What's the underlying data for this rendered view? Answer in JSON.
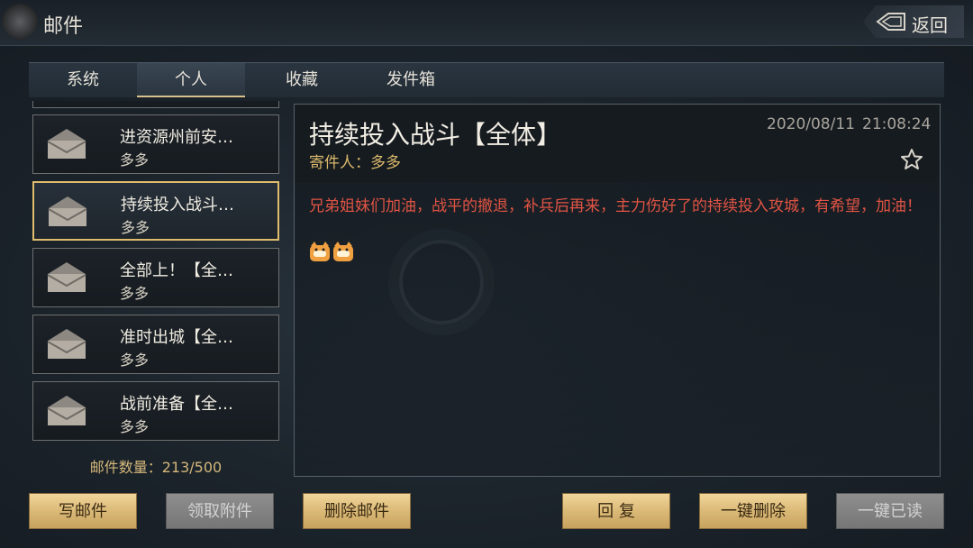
{
  "header": {
    "title": "邮件",
    "back_label": "返回"
  },
  "tabs": [
    {
      "label": "系统"
    },
    {
      "label": "个人",
      "active": true
    },
    {
      "label": "收藏"
    },
    {
      "label": "发件箱"
    }
  ],
  "mail_list": [
    {
      "subject": "进资源州前安…",
      "sender": "多多"
    },
    {
      "subject": "持续投入战斗…",
      "sender": "多多",
      "selected": true
    },
    {
      "subject": "全部上！【全…",
      "sender": "多多"
    },
    {
      "subject": "准时出城【全…",
      "sender": "多多"
    },
    {
      "subject": "战前准备【全…",
      "sender": "多多"
    }
  ],
  "mail_count": "邮件数量：213/500",
  "detail": {
    "title": "持续投入战斗【全体】",
    "date": "2020/08/11",
    "time": "21:08:24",
    "sender_line": "寄件人：多多",
    "body": "兄弟姐妹们加油，战平的撤退，补兵后再来，主力伤好了的持续投入攻城，有希望，加油！",
    "stickers": [
      "tiger-sticker",
      "tiger-sticker"
    ]
  },
  "actions": {
    "write": "写邮件",
    "claim": "领取附件",
    "delete": "删除邮件",
    "reply": "回 复",
    "delete_all": "一键删除",
    "read_all": "一键已读"
  },
  "colors": {
    "accent_gold": "#d9b774",
    "body_red": "#e05444",
    "selected_border": "#e0bd6c"
  }
}
